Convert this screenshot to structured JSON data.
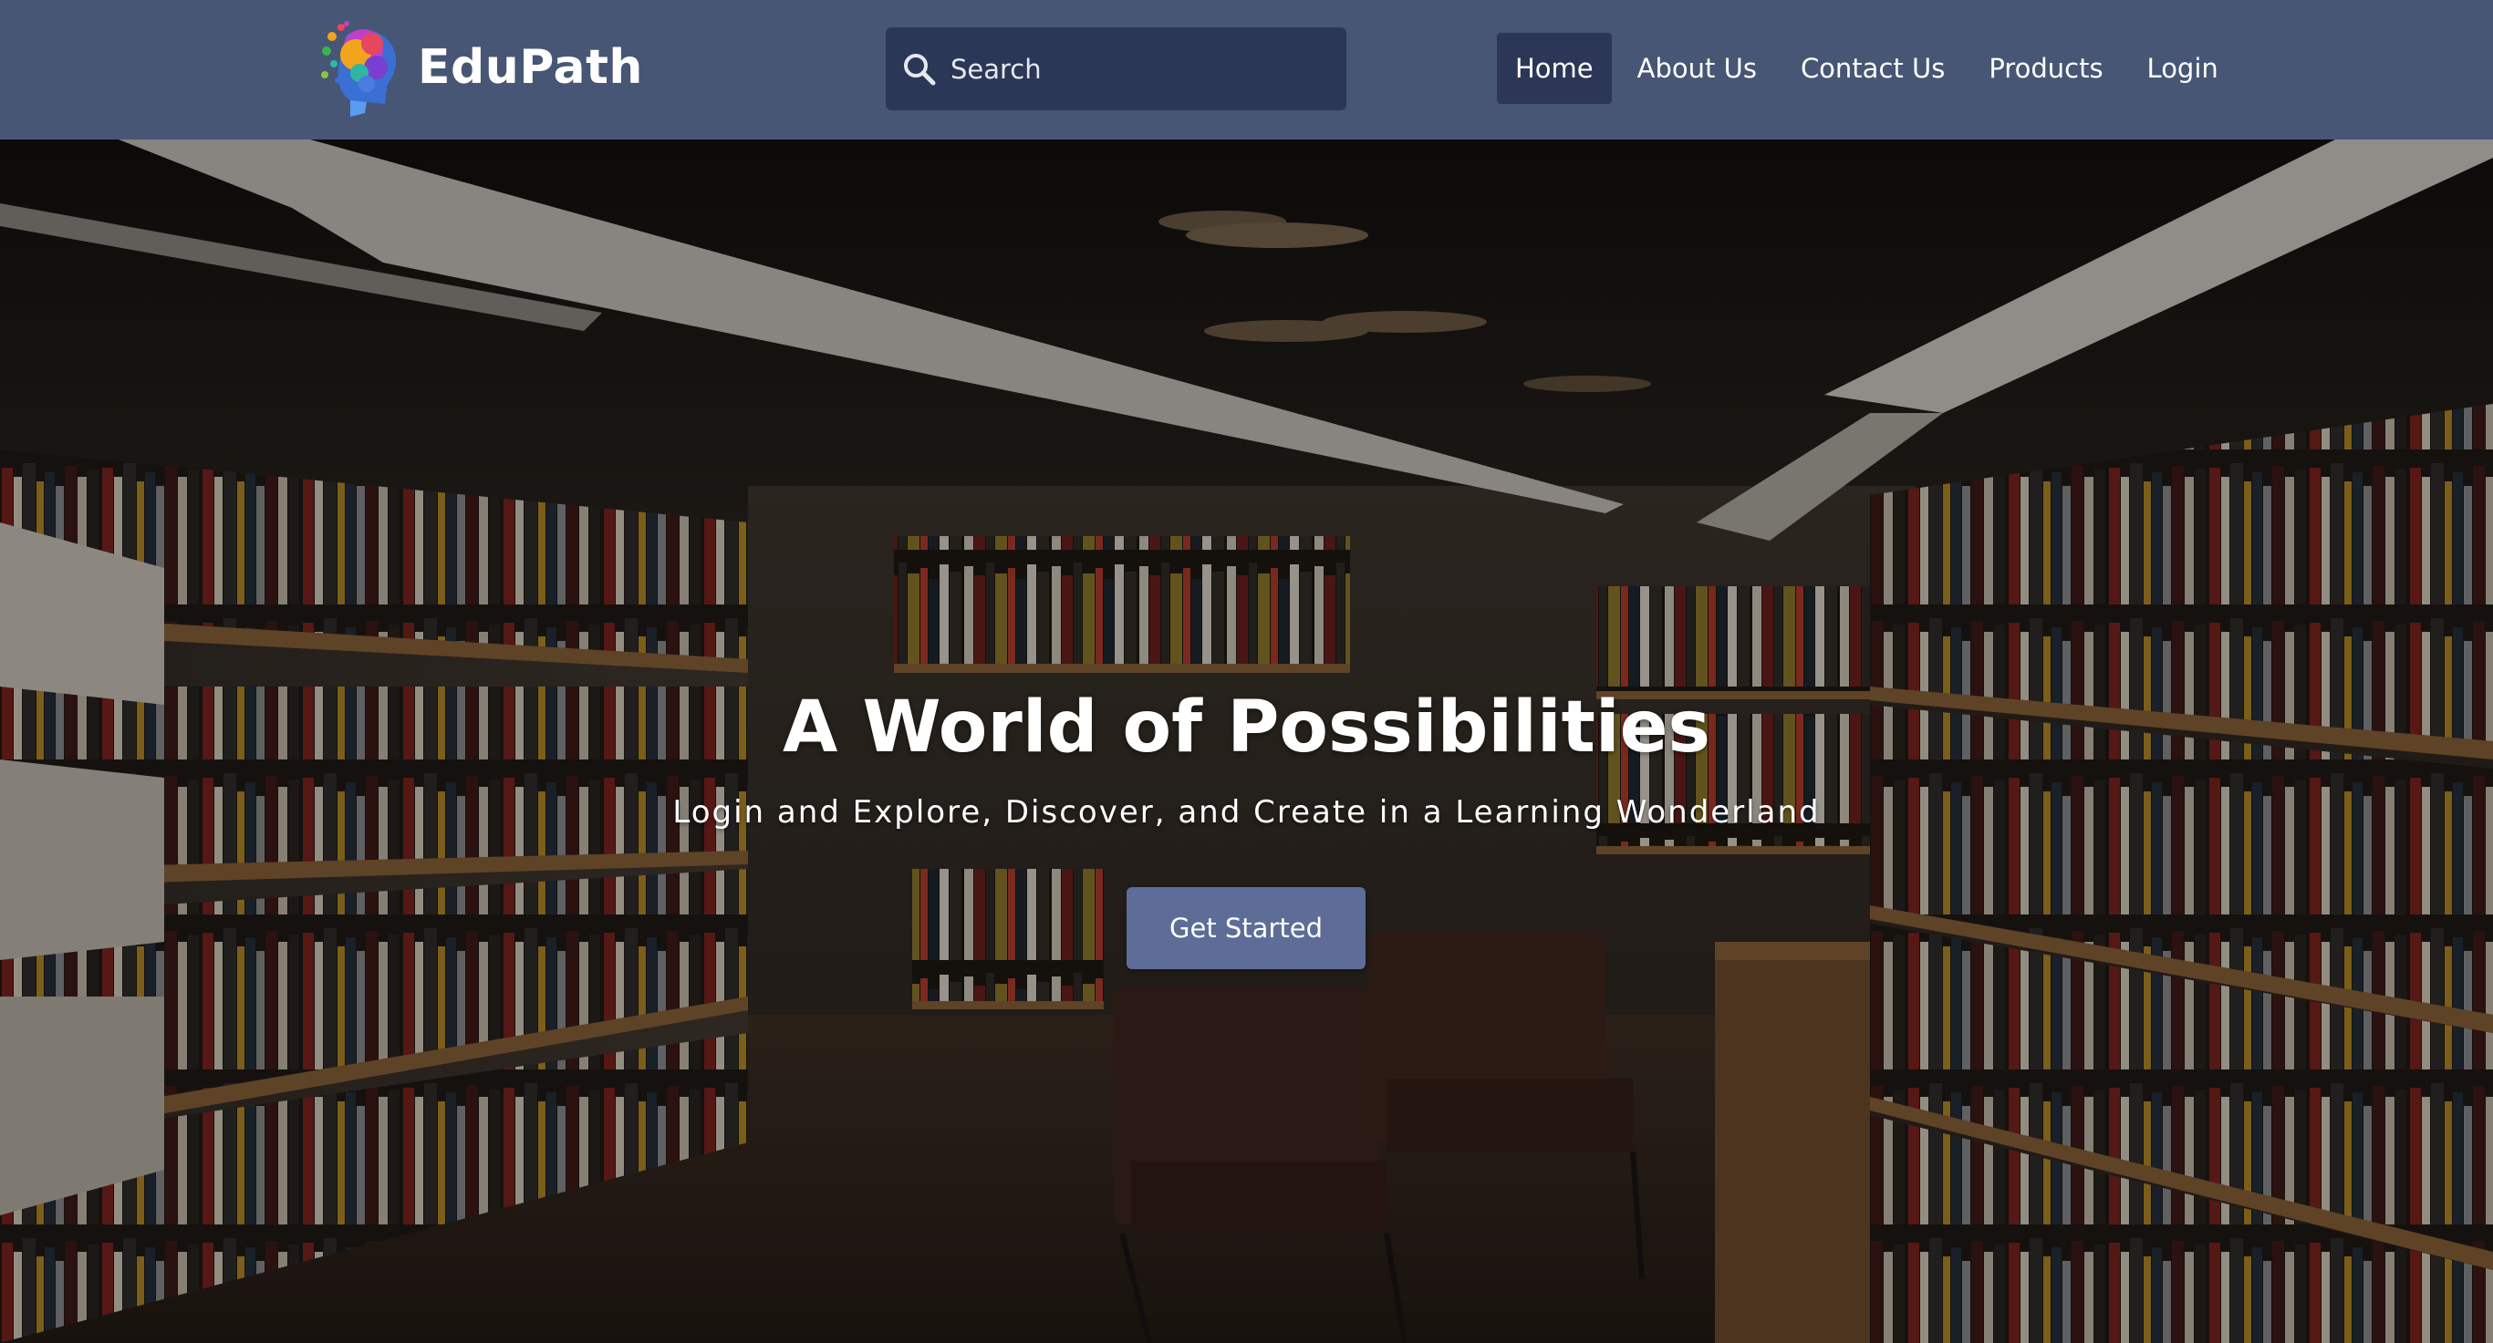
{
  "brand": {
    "name": "EduPath",
    "logo_icon": "colorful-head-icon"
  },
  "search": {
    "placeholder": "Search",
    "value": "",
    "icon": "search-icon"
  },
  "nav": {
    "items": [
      {
        "label": "Home",
        "active": true
      },
      {
        "label": "About Us",
        "active": false
      },
      {
        "label": "Contact Us",
        "active": false
      },
      {
        "label": "Products",
        "active": false
      },
      {
        "label": "Login",
        "active": false
      }
    ]
  },
  "hero": {
    "title": "A World of Possibilities",
    "subtitle": "Login and Explore, Discover, and Create in a Learning Wonderland",
    "cta_label": "Get Started"
  },
  "colors": {
    "navbar_bg": "#465674",
    "search_bg": "#2b3756",
    "nav_active_bg": "#2c3757",
    "cta_bg": "#5d6d98",
    "text": "#ffffff"
  }
}
